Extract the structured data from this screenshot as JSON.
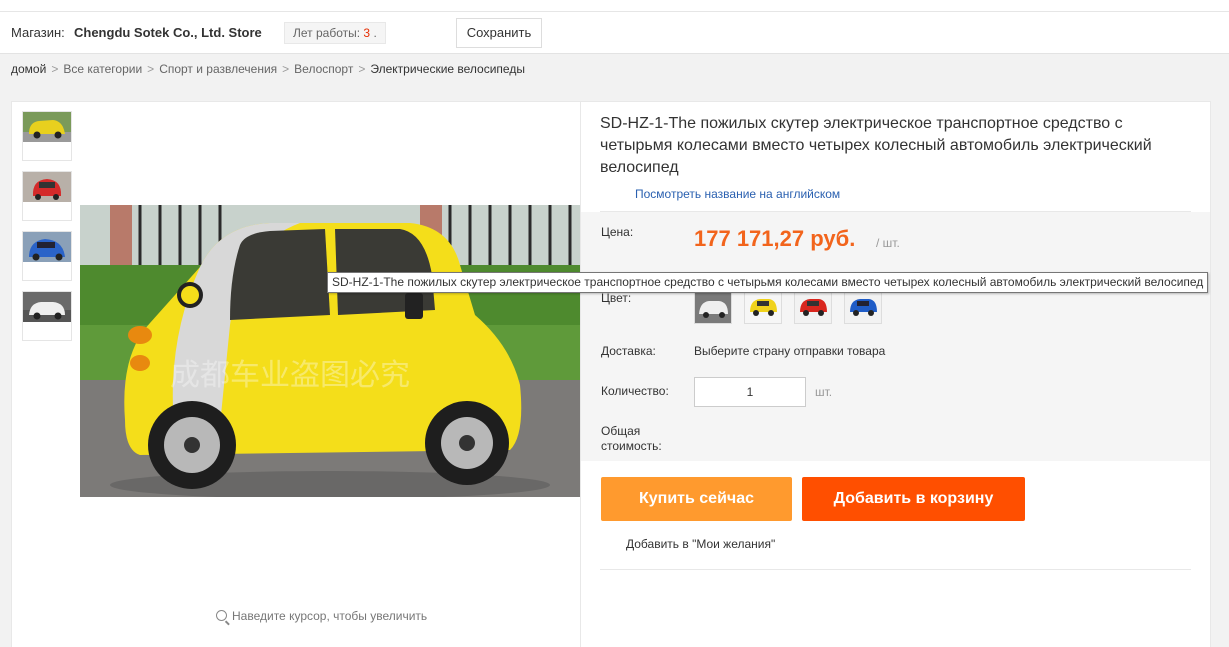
{
  "store_bar": {
    "store_label": "Магазин:",
    "store_name": "Chengdu Sotek Co., Ltd. Store",
    "years_label": "Лет работы:",
    "years_value": "3",
    "years_suffix": ".",
    "save_button": "Сохранить"
  },
  "breadcrumb": [
    "домой",
    "Все категории",
    "Спорт и развлечения",
    "Велоспорт",
    "Электрические велосипеды"
  ],
  "breadcrumb_separator": ">",
  "gallery": {
    "thumbnails": [
      {
        "name": "thumb-yellow-car",
        "color": "#e8d01e"
      },
      {
        "name": "thumb-red-car",
        "color": "#d42a2a"
      },
      {
        "name": "thumb-blue-car",
        "color": "#2a63c8"
      },
      {
        "name": "thumb-white-car",
        "color": "#e6e6e6"
      }
    ],
    "zoom_hint": "Наведите курсор, чтобы увеличить"
  },
  "product": {
    "title": "SD-HZ-1-The пожилых скутер электрическое транспортное средство с четырьмя колесами вместо четырех колесный автомобиль электрический велосипед",
    "english_link": "Посмотреть название на английском",
    "price_label": "Цена:",
    "price": "177 171,27 руб.",
    "price_unit": "/ шт.",
    "color_label": "Цвет:",
    "color_swatches": [
      {
        "name": "swatch-white",
        "color": "#eeeeee"
      },
      {
        "name": "swatch-yellow",
        "color": "#f0d21c"
      },
      {
        "name": "swatch-red",
        "color": "#d9261e"
      },
      {
        "name": "swatch-blue",
        "color": "#1f5cc7"
      }
    ],
    "shipping_label": "Доставка:",
    "shipping_value": "Выберите страну отправки товара",
    "quantity_label": "Количество:",
    "quantity_value": "1",
    "quantity_unit": "шт.",
    "total_label_line1": "Общая",
    "total_label_line2": "стоимость:",
    "buy_now": "Купить сейчас",
    "add_to_cart": "Добавить в корзину",
    "wishlist": "Добавить в \"Мои желания\""
  },
  "tooltip": "SD-HZ-1-The пожилых скутер электрическое транспортное средство с четырьмя колесами вместо четырех колесный автомобиль электрический велосипед",
  "watermark": "成都车业盗图必究",
  "colors": {
    "price": "#f2641c",
    "buy_now": "#ff9a2e",
    "add_to_cart": "#ff4f00",
    "link": "#2a60b0"
  }
}
